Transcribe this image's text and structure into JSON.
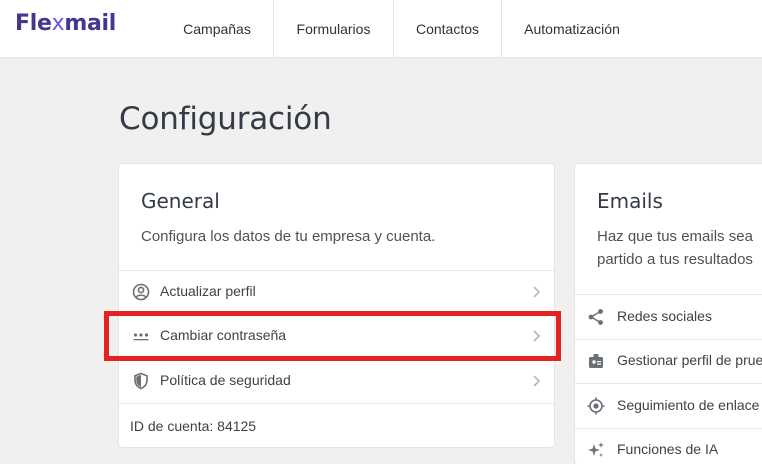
{
  "app": {
    "logo_part1": "Fle",
    "logo_x": "x",
    "logo_part2": "mail"
  },
  "nav": {
    "items": [
      "Campañas",
      "Formularios",
      "Contactos",
      "Automatización"
    ]
  },
  "page": {
    "title": "Configuración"
  },
  "general": {
    "title": "General",
    "description": "Configura los datos de tu empresa y cuenta.",
    "items": [
      {
        "label": "Actualizar perfil",
        "icon": "user-circle-icon"
      },
      {
        "label": "Cambiar contraseña",
        "icon": "password-dots-icon",
        "highlighted": true
      },
      {
        "label": "Política de seguridad",
        "icon": "shield-icon"
      }
    ],
    "account_id": "ID de cuenta: 84125"
  },
  "emails": {
    "title": "Emails",
    "description_line1": "Haz que tus emails sea",
    "description_line2": "partido a tus resultados",
    "items": [
      {
        "label": "Redes sociales",
        "icon": "share-icon"
      },
      {
        "label": "Gestionar perfil de prue",
        "icon": "id-badge-icon"
      },
      {
        "label": "Seguimiento de enlace",
        "icon": "target-icon"
      },
      {
        "label": "Funciones de IA",
        "icon": "sparkles-icon"
      }
    ]
  },
  "colors": {
    "brand": "#45368f",
    "highlight": "#e52222",
    "background": "#eff0ef"
  }
}
